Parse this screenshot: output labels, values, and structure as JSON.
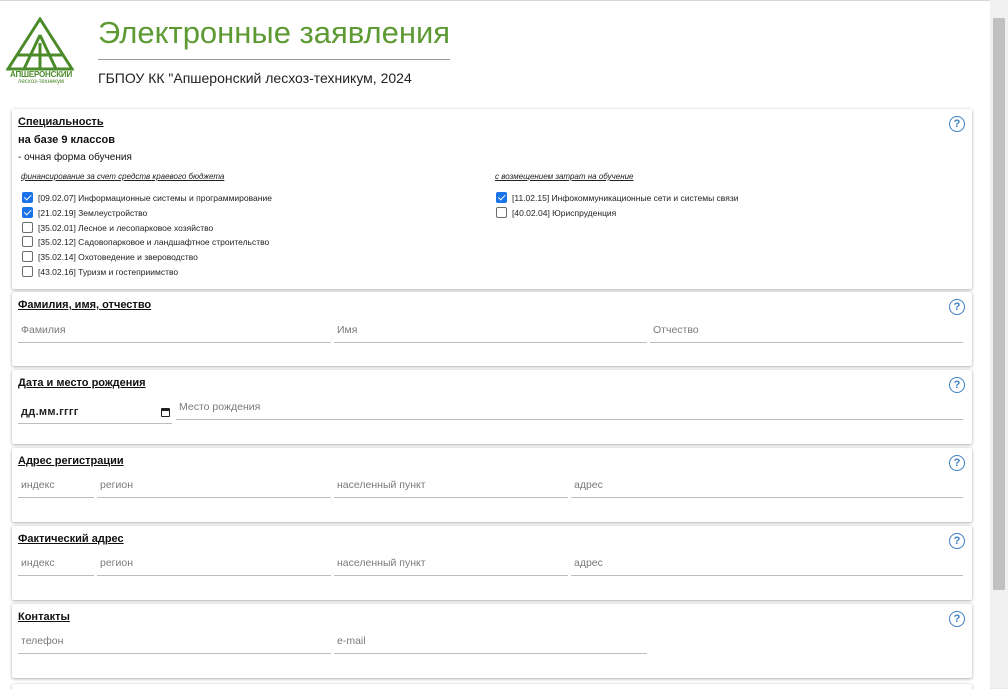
{
  "header": {
    "logo_line1": "АПШЕРОНСКИЙ",
    "logo_line2": "лесхоз-техникум",
    "title": "Электронные заявления",
    "subtitle": "ГБПОУ КК \"Апшеронский лесхоз-техникум, 2024"
  },
  "specialty": {
    "title": "Специальность",
    "base": "на базе 9 классов",
    "form": "- очная форма обучения",
    "budget_group": {
      "title": "финансирование за счет средств краевого бюджета",
      "items": [
        {
          "label": "[09.02.07] Информационные системы и программирование",
          "checked": true
        },
        {
          "label": "[21.02.19] Землеустройство",
          "checked": true
        },
        {
          "label": "[35.02.01] Лесное и лесопарковое хозяйство",
          "checked": false
        },
        {
          "label": "[35.02.12] Садовопарковое и ландшафтное строительство",
          "checked": false
        },
        {
          "label": "[35.02.14] Охотоведение и звероводство",
          "checked": false
        },
        {
          "label": "[43.02.16] Туризм и гостеприимство",
          "checked": false
        }
      ]
    },
    "paid_group": {
      "title": "с возмещением затрат на обучение",
      "items": [
        {
          "label": "[11.02.15] Инфокоммуникационные сети и системы связи",
          "checked": true
        },
        {
          "label": "[40.02.04] Юриспруденция",
          "checked": false
        }
      ]
    }
  },
  "fio": {
    "title": "Фамилия, имя, отчество",
    "surname_placeholder": "Фамилия",
    "name_placeholder": "Имя",
    "patronymic_placeholder": "Отчество"
  },
  "birth": {
    "title": "Дата и место рождения",
    "date_placeholder": "дд.мм.гггг",
    "place_placeholder": "Место рождения"
  },
  "reg_address": {
    "title": "Адрес регистрации",
    "index_placeholder": "индекс",
    "region_placeholder": "регион",
    "locality_placeholder": "населенный пункт",
    "address_placeholder": "адрес"
  },
  "fact_address": {
    "title": "Фактический адрес",
    "index_placeholder": "индекс",
    "region_placeholder": "регион",
    "locality_placeholder": "населенный пункт",
    "address_placeholder": "адрес"
  },
  "contacts": {
    "title": "Контакты",
    "phone_placeholder": "телефон",
    "email_placeholder": "e-mail"
  },
  "help_symbol": "?",
  "icons": {
    "help": "question-circle-icon",
    "calendar": "calendar-icon",
    "logo": "triangle-logo-icon"
  },
  "colors": {
    "brand_green": "#5d9a34",
    "help_blue": "#3a7fc2",
    "checkbox_blue": "#1a73e8"
  }
}
